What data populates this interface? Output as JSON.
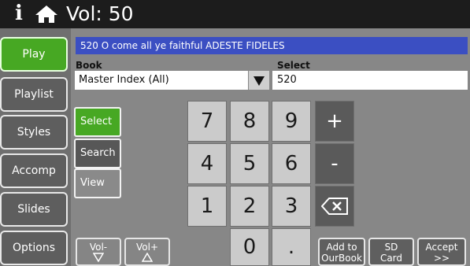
{
  "top": {
    "info": "i",
    "volume": "Vol: 50"
  },
  "sidebar": [
    {
      "label": "Play"
    },
    {
      "label": "Playlist"
    },
    {
      "label": "Styles"
    },
    {
      "label": "Accomp"
    },
    {
      "label": "Slides"
    },
    {
      "label": "Options"
    }
  ],
  "current": {
    "hymn": "520  O come all ye faithful  ADESTE FIDELES"
  },
  "book": {
    "label": "Book",
    "value": "Master Index (All)"
  },
  "select": {
    "label": "Select",
    "value": "520"
  },
  "modes": {
    "select": "Select",
    "search": "Search",
    "view": "View"
  },
  "keypad": {
    "k7": "7",
    "k8": "8",
    "k9": "9",
    "plus": "+",
    "k4": "4",
    "k5": "5",
    "k6": "6",
    "minus": "-",
    "k1": "1",
    "k2": "2",
    "k3": "3",
    "k0": "0",
    "dot": "."
  },
  "bottom": {
    "vol_down_label": "Vol-",
    "vol_up_label": "Vol+",
    "add_line1": "Add to",
    "add_line2": "OurBook",
    "sd_line1": "SD",
    "sd_line2": "Card",
    "accept_line1": "Accept",
    "accept_line2": ">>"
  },
  "colors": {
    "active": "#47a823",
    "banner": "#3b4fc2"
  }
}
